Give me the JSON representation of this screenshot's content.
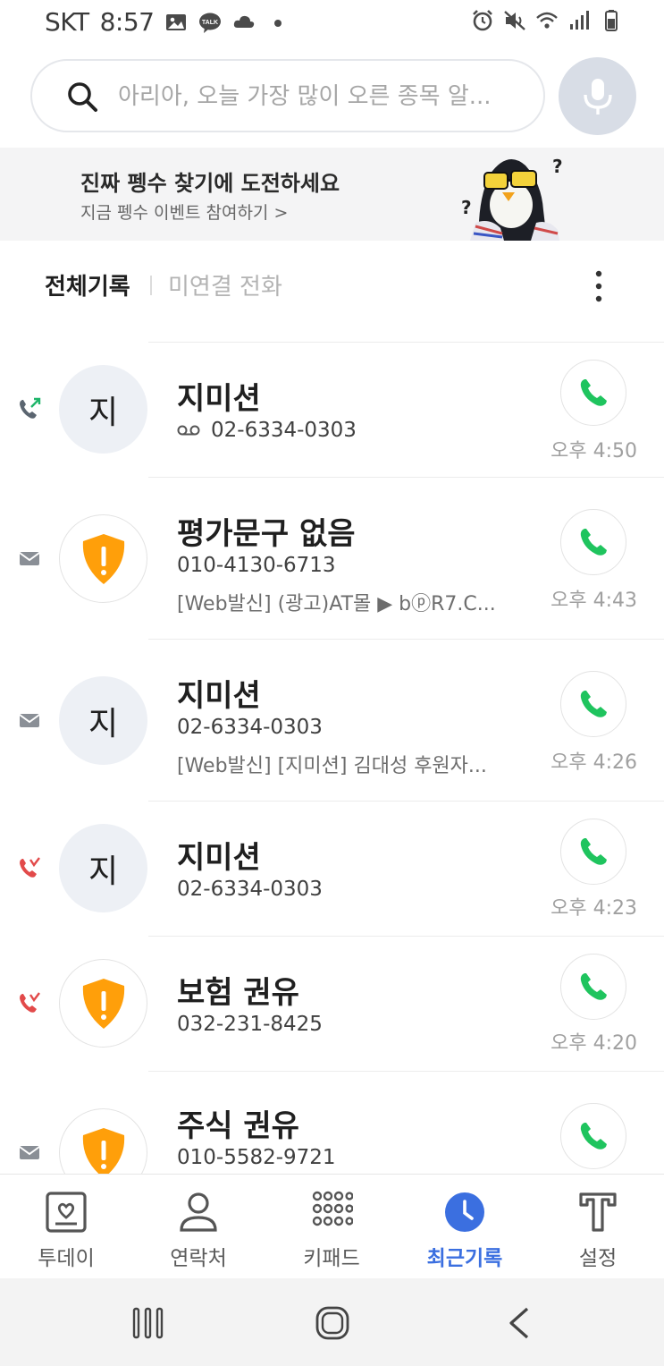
{
  "status_bar": {
    "carrier": "SKT",
    "time": "8:57",
    "left_icons": [
      "image-icon",
      "kakaotalk-icon",
      "cloud-icon",
      "dot-icon"
    ],
    "kakao_badge": "TALK",
    "right_icons": [
      "alarm-icon",
      "mute-icon",
      "wifi-icon",
      "signal-icon",
      "battery-icon"
    ]
  },
  "search": {
    "placeholder": "아리아, 오늘 가장 많이 오른 종목 알...",
    "icon": "search-icon",
    "mic_icon": "mic-icon"
  },
  "banner": {
    "title": "진짜 펭수 찾기에 도전하세요",
    "subtitle": "지금 펭수 이벤트 참여하기 >"
  },
  "tabs": {
    "all": "전체기록",
    "missed": "미연결 전화"
  },
  "calls": [
    {
      "type": "outgoing",
      "avatar": "지",
      "name": "지미션",
      "number": "02-6334-0303",
      "voicemail": true,
      "preview": "",
      "time": "오후 4:50"
    },
    {
      "type": "message",
      "avatar": "shield",
      "name": "평가문구 없음",
      "number": "010-4130-6713",
      "voicemail": false,
      "preview": "[Web발신] (광고)AT몰 ▶ bⓟR7.C...",
      "time": "오후 4:43"
    },
    {
      "type": "message",
      "avatar": "지",
      "name": "지미션",
      "number": "02-6334-0303",
      "voicemail": false,
      "preview": "[Web발신] [지미션]  김대성 후원자...",
      "time": "오후 4:26"
    },
    {
      "type": "missed",
      "avatar": "지",
      "name": "지미션",
      "number": "02-6334-0303",
      "voicemail": false,
      "preview": "",
      "time": "오후 4:23"
    },
    {
      "type": "missed",
      "avatar": "shield",
      "name": "보험 권유",
      "number": "032-231-8425",
      "voicemail": false,
      "preview": "",
      "time": "오후 4:20"
    },
    {
      "type": "message",
      "avatar": "shield",
      "name": "주식 권유",
      "number": "010-5582-9721",
      "voicemail": false,
      "preview": "",
      "time": ""
    }
  ],
  "bottom_nav": {
    "items": [
      {
        "label": "투데이",
        "icon": "today-icon",
        "active": false
      },
      {
        "label": "연락처",
        "icon": "contacts-icon",
        "active": false
      },
      {
        "label": "키패드",
        "icon": "keypad-icon",
        "active": false
      },
      {
        "label": "최근기록",
        "icon": "recents-clock-icon",
        "active": true
      },
      {
        "label": "설정",
        "icon": "settings-t-icon",
        "active": false
      }
    ]
  },
  "colors": {
    "accent_blue": "#3b6fe0",
    "call_green": "#1fc45e",
    "missed_red": "#e24a4a",
    "outgoing_green": "#1fb56a",
    "shield_orange": "#ff9f0a",
    "mic_bg": "#d8dde6"
  }
}
